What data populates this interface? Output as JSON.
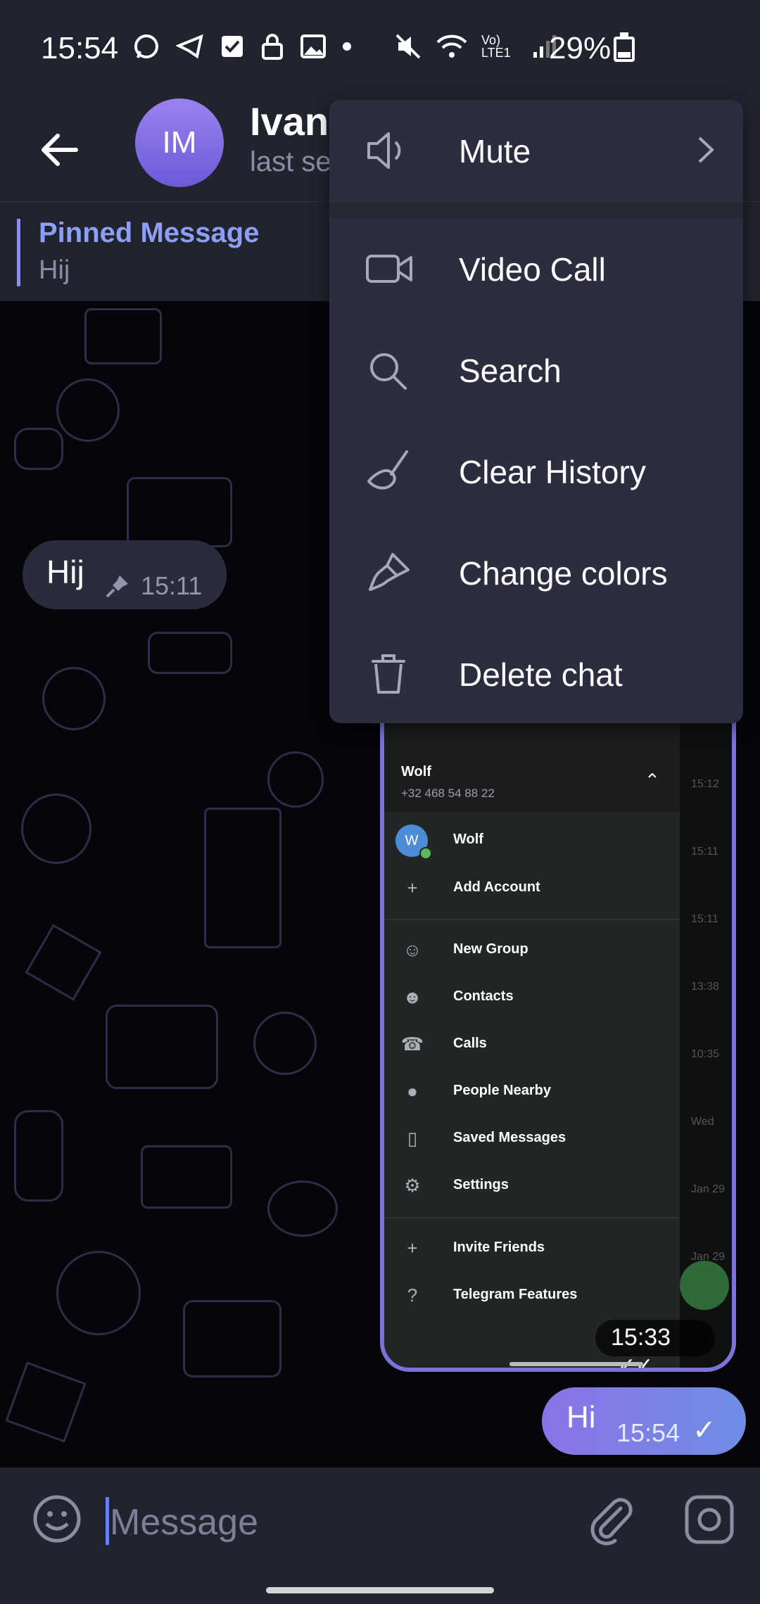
{
  "status_bar": {
    "time": "15:54",
    "battery": "29%",
    "network": "Vo) LTE1"
  },
  "header": {
    "avatar_initials": "IM",
    "name": "Ivan",
    "status": "last se"
  },
  "pinned": {
    "title": "Pinned Message",
    "text": "Hij"
  },
  "messages": {
    "incoming": {
      "text": "Hij",
      "time": "15:11"
    },
    "outgoing": {
      "text": "Hi",
      "time": "15:54"
    }
  },
  "screenshot_message": {
    "account_name": "Wolf",
    "phone": "+32 468 54 88 22",
    "avatar_letter": "W",
    "items": [
      {
        "label": "Wolf"
      },
      {
        "label": "Add Account"
      },
      {
        "label": "New Group"
      },
      {
        "label": "Contacts"
      },
      {
        "label": "Calls"
      },
      {
        "label": "People Nearby"
      },
      {
        "label": "Saved Messages"
      },
      {
        "label": "Settings"
      },
      {
        "label": "Invite Friends"
      },
      {
        "label": "Telegram Features"
      }
    ],
    "right_times": [
      "15:12",
      "15:11",
      "15:11",
      "13:38",
      "10:35",
      "Wed",
      "Jan 29",
      "Jan 29"
    ],
    "time": "15:33"
  },
  "menu": {
    "items": [
      {
        "label": "Mute",
        "icon": "speaker-icon"
      },
      {
        "label": "Video Call",
        "icon": "video-icon"
      },
      {
        "label": "Search",
        "icon": "search-icon"
      },
      {
        "label": "Clear History",
        "icon": "broom-icon"
      },
      {
        "label": "Change colors",
        "icon": "brush-icon"
      },
      {
        "label": "Delete chat",
        "icon": "trash-icon"
      }
    ]
  },
  "composer": {
    "placeholder": "Message"
  },
  "colors": {
    "bar_bg": "#21232f",
    "accent": "#8d9ff5",
    "menu_bg": "#2c2e40",
    "outgoing_bubble": "#7c80e6"
  }
}
